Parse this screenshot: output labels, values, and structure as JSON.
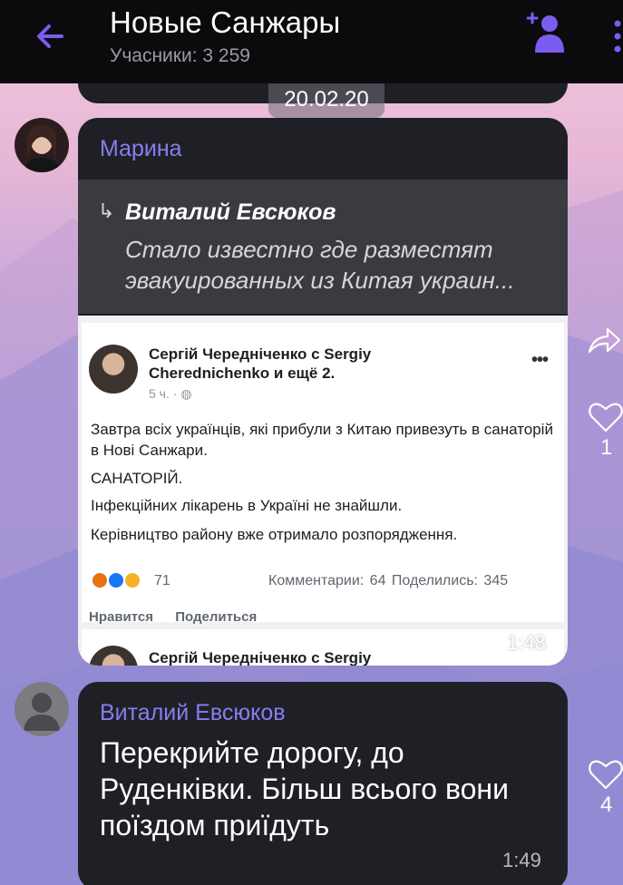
{
  "header": {
    "title": "Новые Санжары",
    "subtitle": "Учасники: 3 259",
    "icons": {
      "back": "back-arrow-icon",
      "add_member": "add-member-icon",
      "more": "more-vertical-icon"
    },
    "accent_color": "#7c5cf0"
  },
  "date_separator": "20.02.20",
  "messages": [
    {
      "sender": "Марина",
      "reply": {
        "author": "Виталий Евсюков",
        "text": "Стало известно где разместят\nэвакуированных из Китая украин..."
      },
      "screenshot": {
        "author": "Сергій Чередніченко с Sergiy Cherednichenko и ещё 2.",
        "time": "5 ч. ·",
        "paragraphs": [
          "Завтра всіх українців, які прибули з Китаю привезуть в санаторій в Нові Санжари.",
          "САНАТОРІЙ.",
          "Інфекційних лікарень в Україні не знайшли.",
          "Керівництво району вже отримало розпорядження."
        ],
        "reaction_count": "71",
        "stats": "Комментарии: 64  Поделились: 345",
        "actions": [
          "Нравится",
          "Поделиться"
        ],
        "next_author": "Сергій Чередніченко с Sergiy"
      },
      "time": "1:48",
      "likes": "1"
    },
    {
      "sender": "Виталий Евсюков",
      "text": "Перекрийте дорогу, до Руденківки. Більш всього вони поїздом приїдуть",
      "time": "1:49",
      "likes": "4"
    }
  ]
}
